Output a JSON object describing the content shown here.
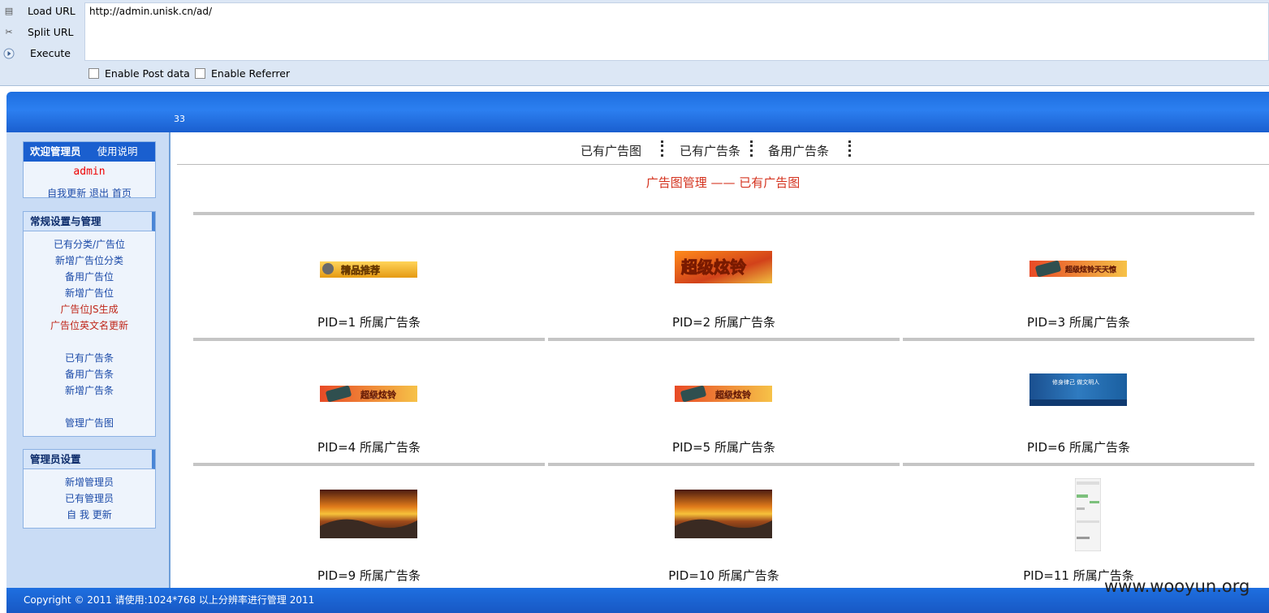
{
  "hackbar": {
    "load_url": "Load URL",
    "split_url": "Split URL",
    "execute": "Execute",
    "url_value": "http://admin.unisk.cn/ad/",
    "enable_post": "Enable Post data",
    "enable_referrer": "Enable Referrer"
  },
  "banner": {
    "number": "33"
  },
  "sidebar": {
    "welcome": {
      "title": "欢迎管理员",
      "help": "使用说明",
      "username": "admin",
      "links": [
        "自我更新",
        "退出",
        "首页"
      ]
    },
    "general": {
      "title": "常规设置与管理",
      "items": [
        "已有分类/广告位",
        "新增广告位分类",
        "备用广告位",
        "新增广告位",
        "广告位JS生成",
        "广告位英文名更新",
        "已有广告条",
        "备用广告条",
        "新增广告条",
        "管理广告图"
      ]
    },
    "admin": {
      "title": "管理员设置",
      "items": [
        "新增管理员",
        "已有管理员",
        "自 我 更新"
      ]
    }
  },
  "tabs": [
    "已有广告图",
    "已有广告条",
    "备用广告条"
  ],
  "page_title": "广告图管理 —— 已有广告图",
  "ads": [
    {
      "caption": "PID=1 所属广告条",
      "image": "精品推荐"
    },
    {
      "caption": "PID=2 所属广告条",
      "image": "超级炫铃"
    },
    {
      "caption": "PID=3 所属广告条",
      "image": "超级炫铃天天惊"
    },
    {
      "caption": "PID=4 所属广告条",
      "image": "超级炫铃"
    },
    {
      "caption": "PID=5 所属广告条",
      "image": "超级炫铃"
    },
    {
      "caption": "PID=6 所属广告条",
      "image": "修身律己 做文明人"
    },
    {
      "caption": "PID=9 所属广告条",
      "image": "sunset"
    },
    {
      "caption": "PID=10 所属广告条",
      "image": "sunset"
    },
    {
      "caption": "PID=11 所属广告条",
      "image": "screenshot"
    }
  ],
  "footer": "Copyright © 2011 请使用:1024*768 以上分辨率进行管理 2011",
  "watermark": "www.wooyun.org"
}
